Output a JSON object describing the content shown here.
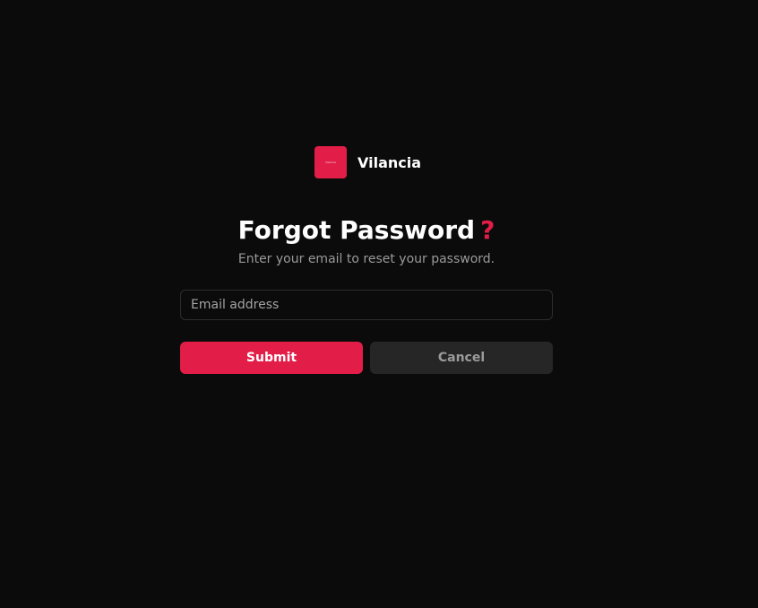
{
  "brand": {
    "name": "Vilancia",
    "logo_mark": "Vilancia"
  },
  "heading": {
    "title": "Forgot Password",
    "title_mark": "?",
    "subtitle": "Enter your email to reset your password."
  },
  "form": {
    "email_placeholder": "Email address",
    "email_value": ""
  },
  "actions": {
    "submit_label": "Submit",
    "cancel_label": "Cancel"
  },
  "colors": {
    "background": "#0b0b0b",
    "accent": "#e11d48",
    "secondary_button": "#262626"
  }
}
